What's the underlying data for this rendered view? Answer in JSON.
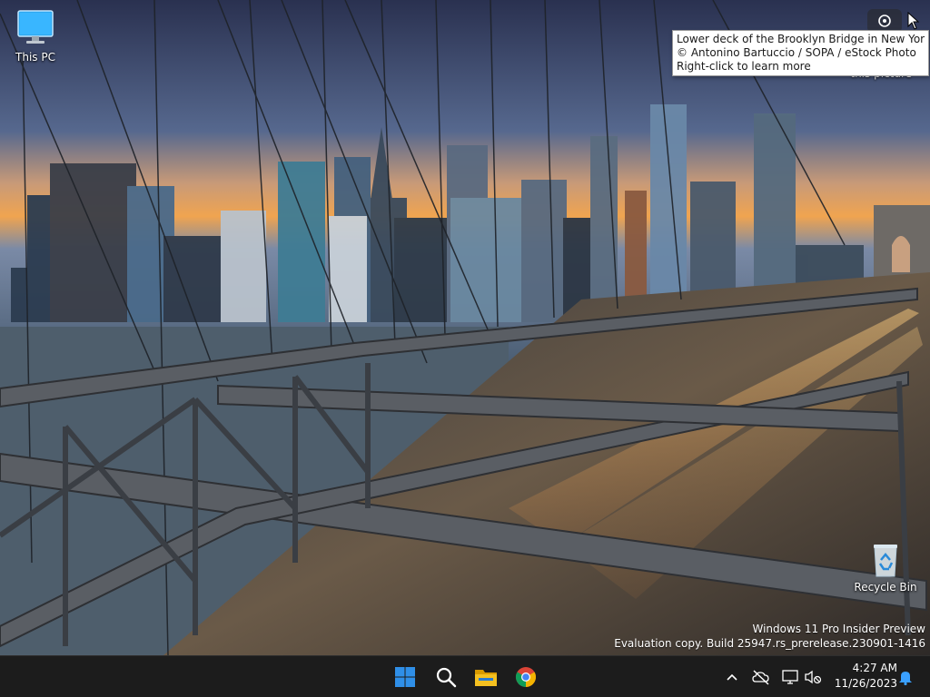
{
  "desktop": {
    "icons": [
      {
        "label": "This PC",
        "icon": "monitor-icon"
      },
      {
        "label": "Recycle Bin",
        "icon": "recycle-bin-icon"
      }
    ],
    "wallpaper_tooltip": {
      "line1": "Lower deck of the Brooklyn Bridge in New York City",
      "line2": "© Antonino Bartuccio / SOPA / eStock Photo",
      "line3": "Right-click to learn more"
    },
    "partial_behind_text": "this picture",
    "watermark": {
      "line1": "Windows 11 Pro Insider Preview",
      "line2": "Evaluation copy. Build 25947.rs_prerelease.230901-1416"
    }
  },
  "taskbar": {
    "pinned": [
      {
        "name": "start",
        "icon": "windows-logo-icon"
      },
      {
        "name": "search",
        "icon": "search-icon"
      },
      {
        "name": "file-explorer",
        "icon": "folder-icon"
      },
      {
        "name": "chrome",
        "icon": "chrome-icon"
      }
    ],
    "tray": [
      {
        "name": "show-hidden-icons",
        "icon": "chevron-up-icon"
      },
      {
        "name": "network-crossed",
        "icon": "cloud-off-icon"
      },
      {
        "name": "display",
        "icon": "monitor-icon"
      },
      {
        "name": "volume-muted",
        "icon": "speaker-muted-icon"
      }
    ],
    "clock": {
      "time": "4:27 AM",
      "date": "11/26/2023"
    },
    "notifications_icon": "bell-icon"
  },
  "colors": {
    "taskbar_bg": "#1c1c1c",
    "windows_blue": "#2f8fe8",
    "folder_yellow": "#f0b400",
    "notification_blue": "#3aa0ff"
  }
}
